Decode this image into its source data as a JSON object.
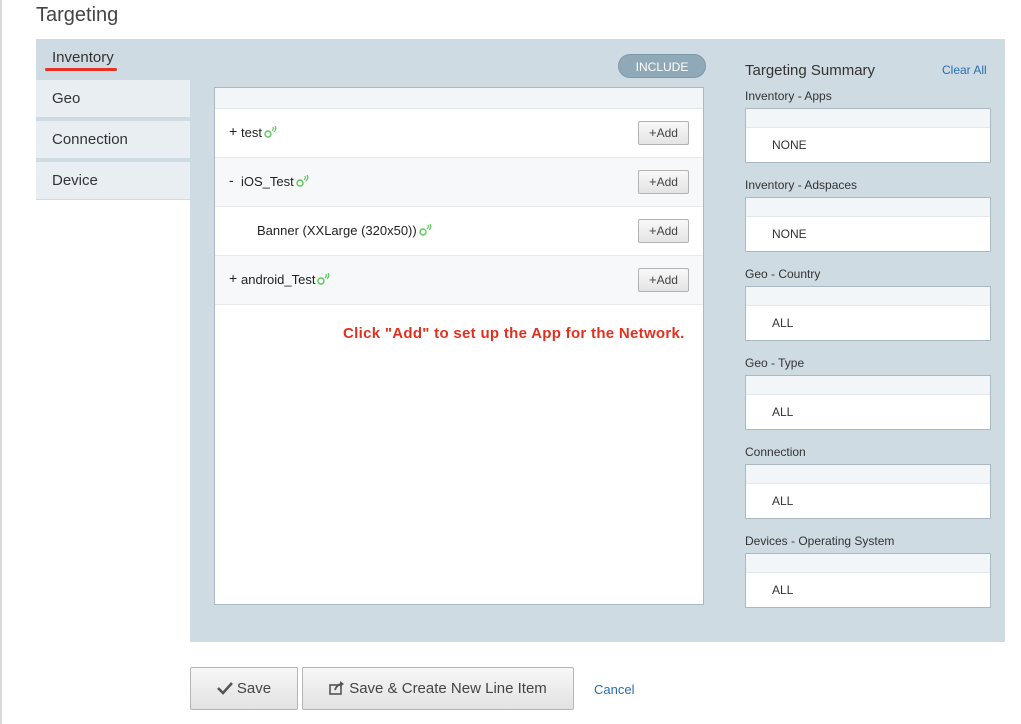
{
  "page": {
    "title": "Targeting"
  },
  "tabs": [
    {
      "label": "Inventory",
      "active": true
    },
    {
      "label": "Geo"
    },
    {
      "label": "Connection"
    },
    {
      "label": "Device"
    }
  ],
  "include_label": "INCLUDE",
  "inventory": {
    "rows": [
      {
        "toggle": "+",
        "label": "test",
        "add_plus": "+",
        "add_label": "Add",
        "icon": "signal-icon"
      },
      {
        "toggle": "-",
        "label": "iOS_Test",
        "add_plus": "+",
        "add_label": "Add",
        "icon": "signal-icon"
      },
      {
        "toggle": "",
        "label": "Banner (XXLarge (320x50))",
        "add_plus": "+",
        "add_label": "Add",
        "icon": "signal-icon"
      },
      {
        "toggle": "+",
        "label": "android_Test",
        "add_plus": "+",
        "add_label": "Add",
        "icon": "signal-icon"
      }
    ],
    "hint": "Click \"Add\" to set up the App for the Network."
  },
  "summary": {
    "title": "Targeting Summary",
    "clear_all": "Clear All",
    "groups": [
      {
        "label": "Inventory - Apps",
        "value": "NONE"
      },
      {
        "label": "Inventory - Adspaces",
        "value": "NONE"
      },
      {
        "label": "Geo - Country",
        "value": "ALL"
      },
      {
        "label": "Geo - Type",
        "value": "ALL"
      },
      {
        "label": "Connection",
        "value": "ALL"
      },
      {
        "label": "Devices - Operating System",
        "value": "ALL"
      }
    ]
  },
  "actions": {
    "save": "Save",
    "save_create": "Save & Create New Line Item",
    "cancel": "Cancel"
  },
  "colors": {
    "panel_bg": "#cfdbe2",
    "hint_red": "#e2301f",
    "link_blue": "#2a6db3",
    "signal_green": "#5cc85c"
  }
}
